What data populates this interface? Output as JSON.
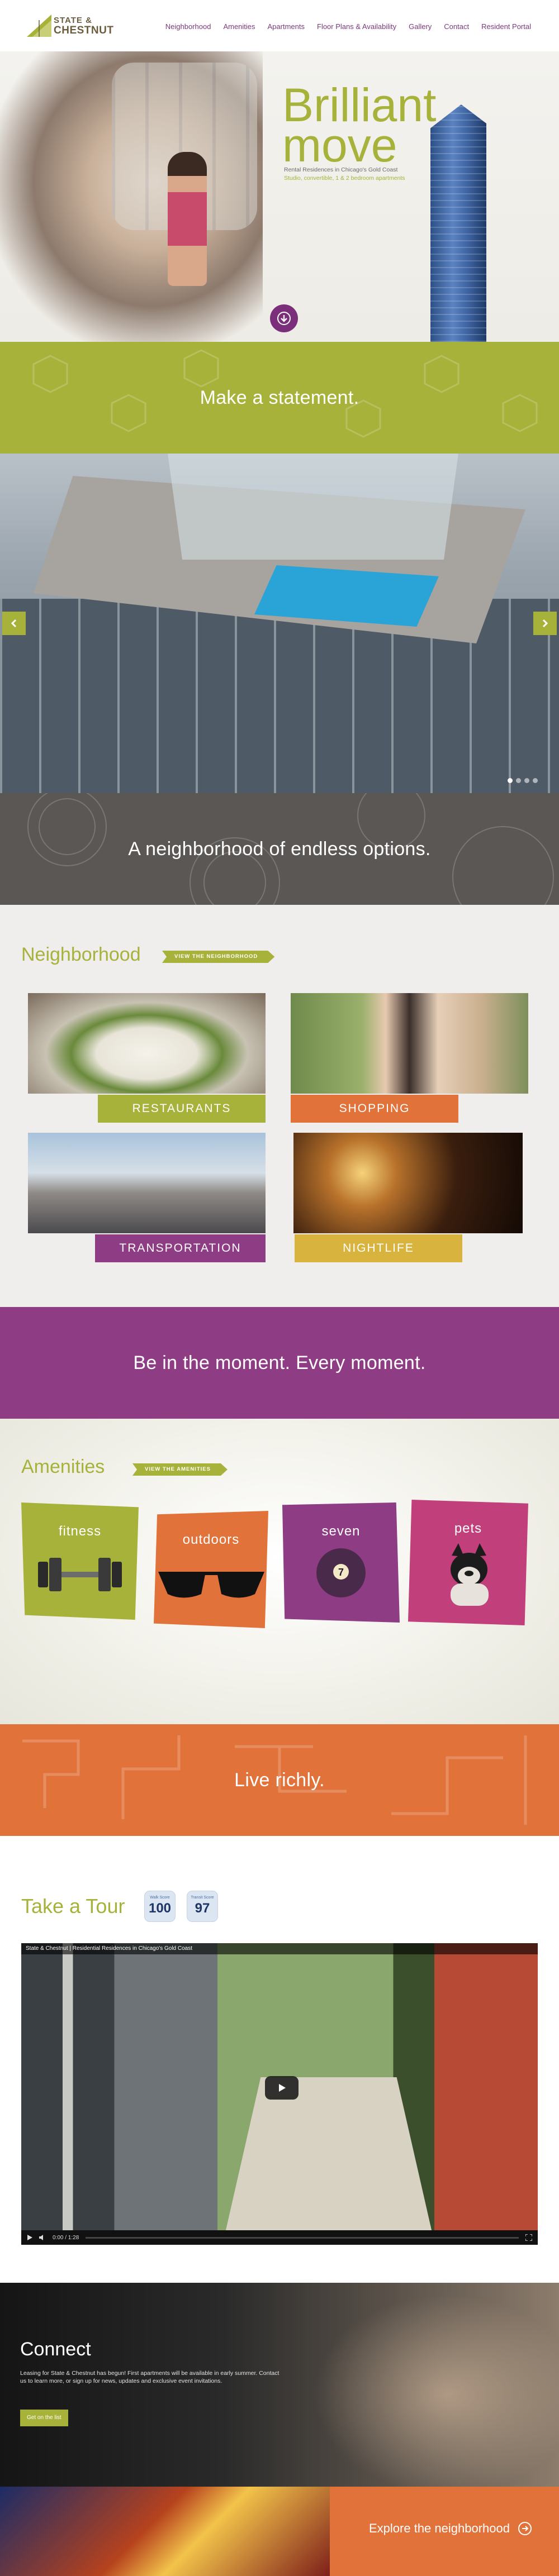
{
  "header": {
    "logo_line1": "STATE &",
    "logo_line2": "CHESTNUT",
    "nav": [
      "Neighborhood",
      "Amenities",
      "Apartments",
      "Floor Plans & Availability",
      "Gallery",
      "Contact",
      "Resident Portal"
    ]
  },
  "hero": {
    "title_line1": "Brilliant",
    "title_line2": "move",
    "subtitle": "Rental Residences in Chicago's Gold Coast",
    "subtitle2": "Studio, convertible, 1 & 2 bedroom apartments"
  },
  "bands": {
    "statement": "Make a statement.",
    "neighborhood": "A neighborhood of endless options.",
    "moment": "Be in the moment. Every moment.",
    "live": "Live richly."
  },
  "slider": {
    "dot_count": 4,
    "active_dot": 0
  },
  "neighborhood": {
    "title": "Neighborhood",
    "view_link": "VIEW THE NEIGHBORHOOD",
    "tiles": [
      "RESTAURANTS",
      "SHOPPING",
      "TRANSPORTATION",
      "NIGHTLIFE"
    ]
  },
  "amenities": {
    "title": "Amenities",
    "view_link": "VIEW THE AMENITIES",
    "cards": [
      "fitness",
      "outdoors",
      "seven",
      "pets"
    ],
    "ball_number": "7"
  },
  "tour": {
    "title": "Take a Tour",
    "walk_score_label": "Walk Score",
    "walk_score": "100",
    "transit_score_label": "Transit Score",
    "transit_score": "97",
    "video_title": "State & Chestnut | Residential Residences in Chicago's Gold Coast",
    "video_time": "0:00 / 1:28"
  },
  "connect": {
    "title": "Connect",
    "text": "Leasing for State & Chestnut has begun! First apartments will be available in early summer. Contact us to learn more, or sign up for news, updates and exclusive event invitations.",
    "button": "Get on the list"
  },
  "explore": {
    "link": "Explore the neighborhood"
  },
  "colors": {
    "green": "#a7b23a",
    "purple": "#8e3c83",
    "orange": "#e1733a",
    "gray": "#5b5755"
  }
}
